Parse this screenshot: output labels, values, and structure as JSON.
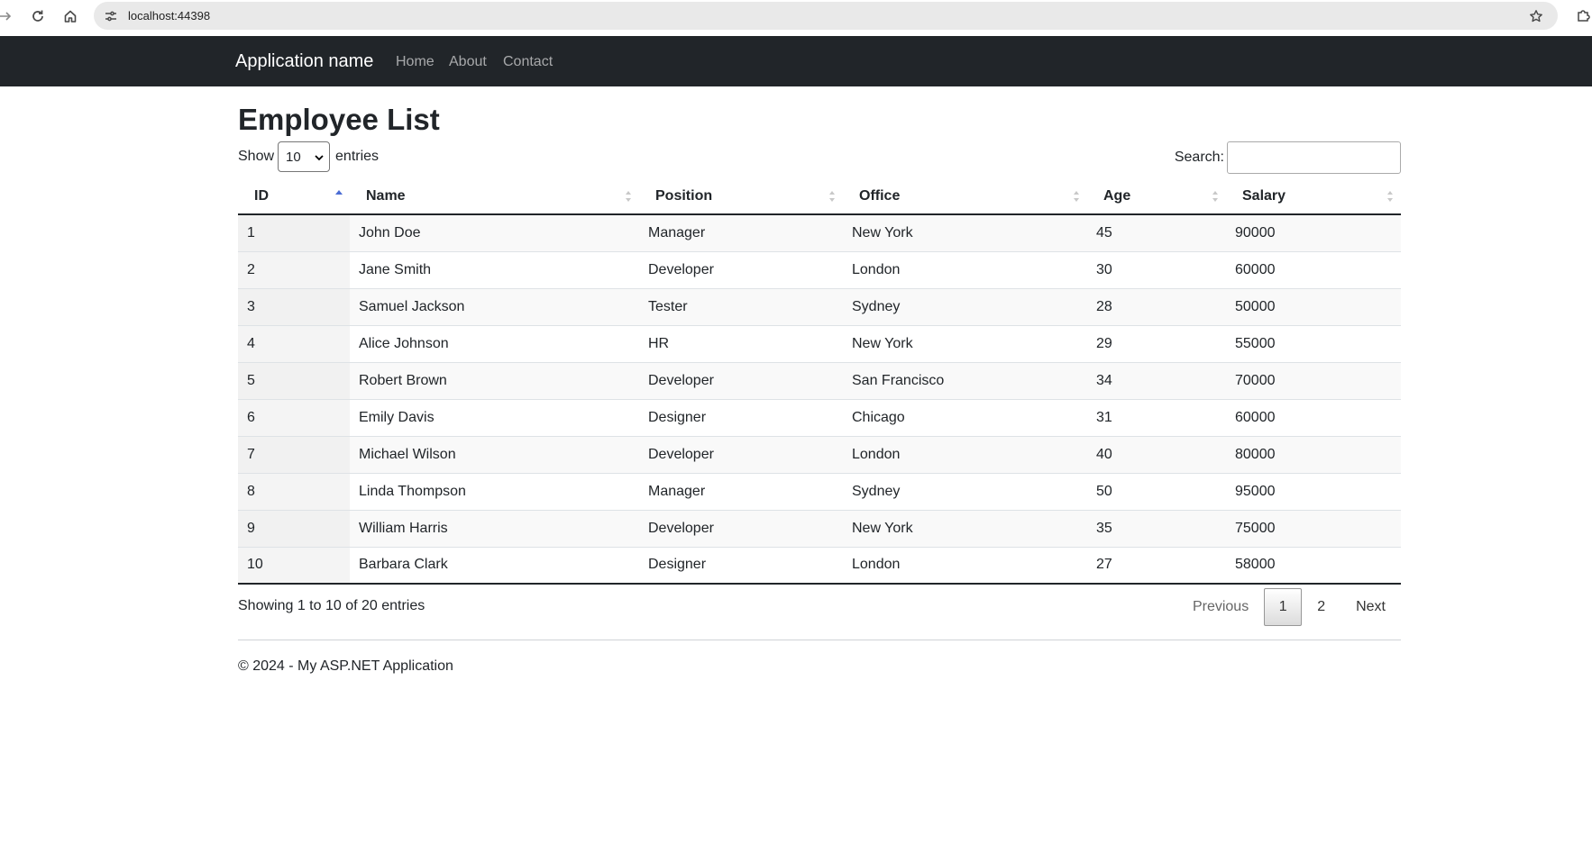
{
  "browser": {
    "url": "localhost:44398"
  },
  "navbar": {
    "brand": "Application name",
    "links": [
      "Home",
      "About",
      "Contact"
    ],
    "background": "#212529"
  },
  "page": {
    "title": "Employee List",
    "length_prefix": "Show",
    "length_value": "10",
    "length_suffix": "entries",
    "search_label": "Search:",
    "search_value": "",
    "info": "Showing 1 to 10 of 20 entries",
    "pagination": {
      "previous": "Previous",
      "pages": [
        "1",
        "2"
      ],
      "current": "1",
      "next": "Next"
    },
    "copyright": "© 2024 - My ASP.NET Application"
  },
  "table": {
    "columns": [
      "ID",
      "Name",
      "Position",
      "Office",
      "Age",
      "Salary"
    ],
    "sorted_column": "ID",
    "sort_direction": "ascending",
    "rows": [
      [
        "1",
        "John Doe",
        "Manager",
        "New York",
        "45",
        "90000"
      ],
      [
        "2",
        "Jane Smith",
        "Developer",
        "London",
        "30",
        "60000"
      ],
      [
        "3",
        "Samuel Jackson",
        "Tester",
        "Sydney",
        "28",
        "50000"
      ],
      [
        "4",
        "Alice Johnson",
        "HR",
        "New York",
        "29",
        "55000"
      ],
      [
        "5",
        "Robert Brown",
        "Developer",
        "San Francisco",
        "34",
        "70000"
      ],
      [
        "6",
        "Emily Davis",
        "Designer",
        "Chicago",
        "31",
        "60000"
      ],
      [
        "7",
        "Michael Wilson",
        "Developer",
        "London",
        "40",
        "80000"
      ],
      [
        "8",
        "Linda Thompson",
        "Manager",
        "Sydney",
        "50",
        "95000"
      ],
      [
        "9",
        "William Harris",
        "Developer",
        "New York",
        "35",
        "75000"
      ],
      [
        "10",
        "Barbara Clark",
        "Designer",
        "London",
        "27",
        "58000"
      ]
    ]
  },
  "icons": {
    "back": "arrow-right-icon",
    "reload": "reload-icon",
    "home": "home-icon",
    "site_info": "tune-icon",
    "bookmark": "star-icon",
    "extensions": "puzzle-icon"
  }
}
